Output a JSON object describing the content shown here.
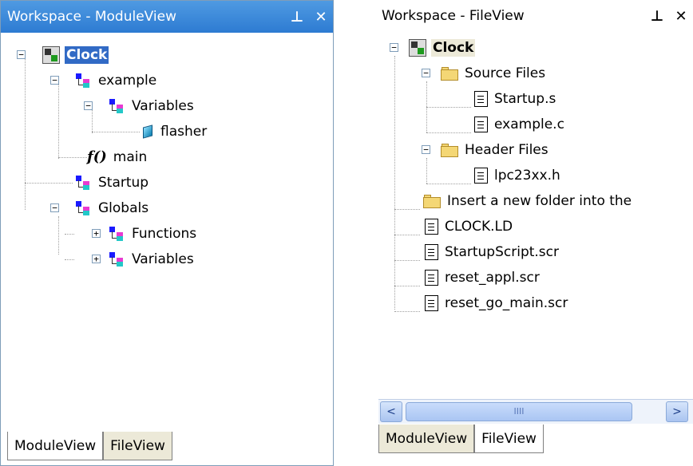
{
  "left": {
    "title": "Workspace - ModuleView",
    "pin_glyph": "Ԅ",
    "close_glyph": "✕",
    "tree": {
      "root": "Clock",
      "example": "example",
      "variables": "Variables",
      "flasher": "flasher",
      "main_fn": "f()",
      "main": "main",
      "startup": "Startup",
      "globals": "Globals",
      "functions": "Functions",
      "variables2": "Variables"
    },
    "tabs": [
      "ModuleView",
      "FileView"
    ],
    "active_tab": "ModuleView"
  },
  "right": {
    "title": "Workspace - FileView",
    "pin_glyph": "Ԅ",
    "close_glyph": "✕",
    "tree": {
      "root": "Clock",
      "source_files": "Source Files",
      "startup_s": "Startup.s",
      "example_c": "example.c",
      "header_files": "Header Files",
      "lpc_h": "lpc23xx.h",
      "insert_folder": "Insert a new folder into the",
      "clock_ld": "CLOCK.LD",
      "startup_script": "StartupScript.scr",
      "reset_appl": "reset_appl.scr",
      "reset_go_main": "reset_go_main.scr"
    },
    "scroll": {
      "left_glyph": "<",
      "right_glyph": ">",
      "thumb_glyph": "IIII"
    },
    "tabs": [
      "ModuleView",
      "FileView"
    ],
    "active_tab": "FileView"
  },
  "colors": {
    "titlebar": "#2d7bd2",
    "selection": "#316ac5",
    "border": "#7f9db9"
  }
}
